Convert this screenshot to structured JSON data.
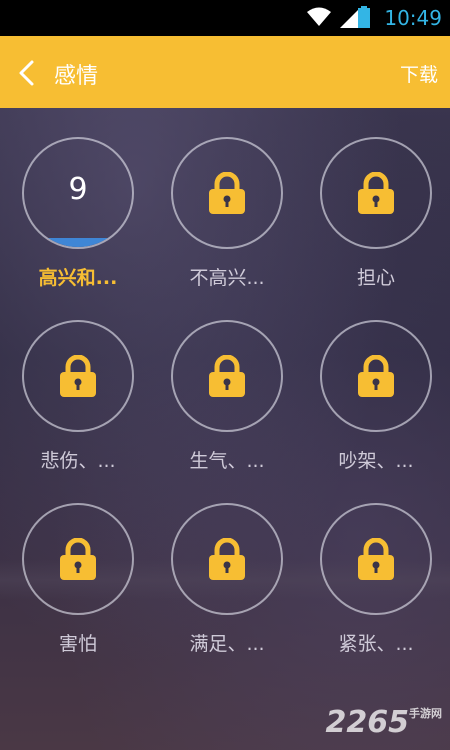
{
  "status_bar": {
    "time": "10:49"
  },
  "header": {
    "title": "感情",
    "download_label": "下载"
  },
  "grid": [
    {
      "label": "高兴和...",
      "locked": false,
      "count": "9",
      "progress": 0.08
    },
    {
      "label": "不高兴...",
      "locked": true
    },
    {
      "label": "担心",
      "locked": true
    },
    {
      "label": "悲伤、...",
      "locked": true
    },
    {
      "label": "生气、...",
      "locked": true
    },
    {
      "label": "吵架、...",
      "locked": true
    },
    {
      "label": "害怕",
      "locked": true
    },
    {
      "label": "满足、...",
      "locked": true
    },
    {
      "label": "紧张、...",
      "locked": true
    }
  ],
  "watermark": {
    "text": "2265",
    "sub": "手游网"
  },
  "colors": {
    "accent": "#f7be33",
    "progress": "#3f86d6"
  }
}
